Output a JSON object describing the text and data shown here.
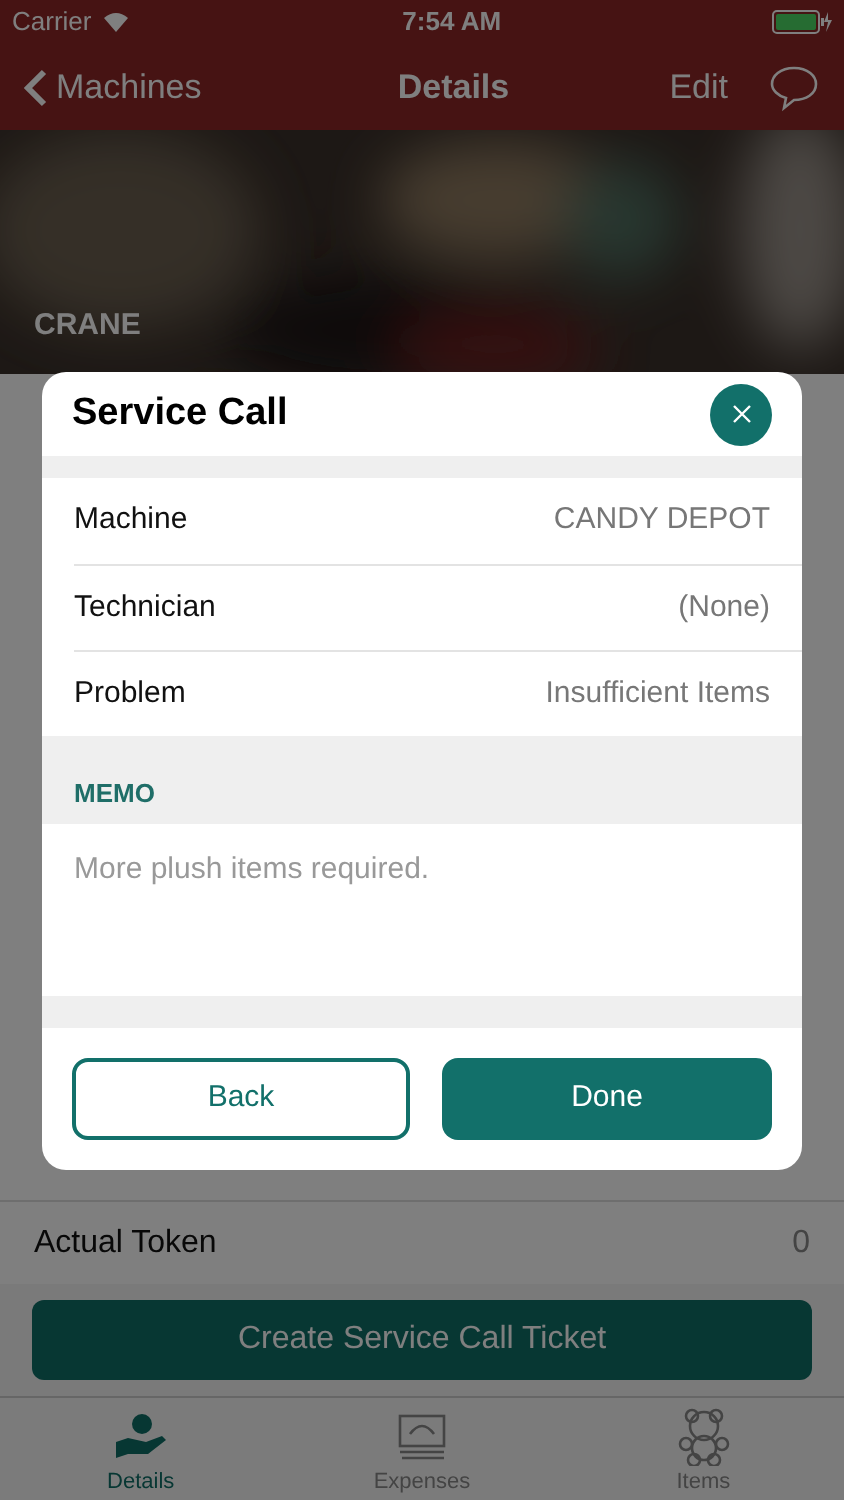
{
  "status_bar": {
    "carrier": "Carrier",
    "time": "7:54 AM"
  },
  "nav": {
    "back": "Machines",
    "title": "Details",
    "edit": "Edit"
  },
  "hero": {
    "kind": "picture",
    "caption": "CRANE"
  },
  "rows": [
    {
      "label": "Actual Token",
      "value": "0"
    }
  ],
  "action_button": "Create Service Call Ticket",
  "tabs": [
    {
      "label": "Details",
      "selected": true,
      "kind": "hand"
    },
    {
      "label": "Expenses",
      "selected": false,
      "kind": "money"
    },
    {
      "label": "Items",
      "selected": false,
      "kind": "bear"
    }
  ],
  "modal": {
    "title": "Service Call",
    "fields": [
      {
        "label": "Machine",
        "value": "CANDY DEPOT"
      },
      {
        "label": "Technician",
        "value": "(None)"
      },
      {
        "label": "Problem",
        "value": "Insufficient Items"
      }
    ],
    "memo_header": "MEMO",
    "memo": "More plush items required.",
    "buttons": [
      {
        "label": "Back",
        "kind": "outline"
      },
      {
        "label": "Done",
        "kind": "filled"
      }
    ]
  }
}
